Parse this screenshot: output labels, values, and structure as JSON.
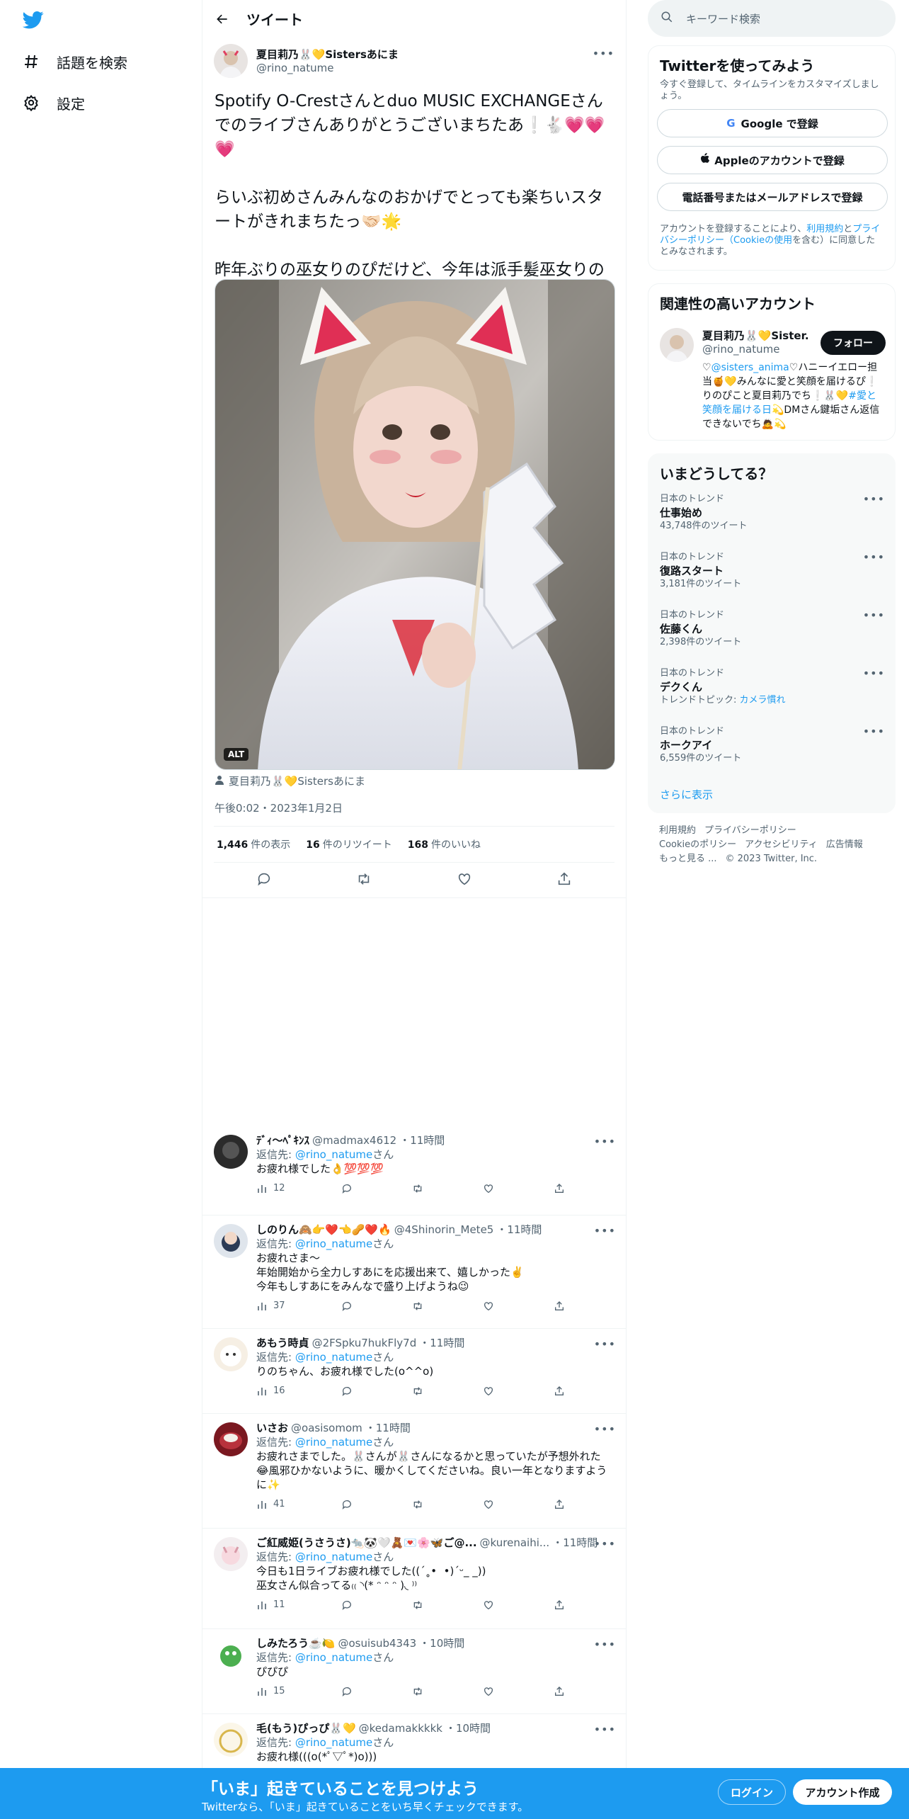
{
  "nav": {
    "explore": "話題を検索",
    "settings": "設定"
  },
  "header": {
    "title": "ツイート"
  },
  "tweet": {
    "display_name": "夏目莉乃🐰💛Sistersあにま",
    "handle": "@rino_natume",
    "text": "Spotify O-Crestさんとduo MUSIC EXCHANGEさんでのライブさんありがとうございまちたあ❕🐇💗💗💗\n\nらいぶ初めさんみんなのおかげでとっても楽ちいスタートがきれまちたっ🤝🏻🌟\n\n昨年ぶりの巫女りのぴだけど、今年は派手髪巫女りのぴ〜🦊🎶❤️",
    "alt_badge": "ALT",
    "tagged": "夏目莉乃🐰💛Sistersあにま",
    "timestamp": "午後0:02・2023年1月2日",
    "views_count": "1,446",
    "views_label": "件の表示",
    "retweets_count": "16",
    "retweets_label": "件のリツイート",
    "likes_count": "168",
    "likes_label": "件のいいね"
  },
  "replies": [
    {
      "name": "ﾃﾞｨ〜ﾍﾟｷﾝｽ",
      "handle": "@madmax4612",
      "time": "・11時間",
      "reply_prefix": "返信先: ",
      "reply_to": "@rino_natume",
      "reply_suffix": "さん",
      "text": "お疲れ様でした👌💯💯💯",
      "views": "12"
    },
    {
      "name": "しのりん🙈👉❤️👈🥜❤️🔥",
      "handle": "@4Shinorin_Mete5",
      "time": "・11時間",
      "reply_prefix": "返信先: ",
      "reply_to": "@rino_natume",
      "reply_suffix": "さん",
      "text": "お疲れさま〜\n年始開始から全力しすあにを応援出来て、嬉しかった✌️\n今年もしすあにをみんなで盛り上げようね😉",
      "views": "37"
    },
    {
      "name": "あもう時貞",
      "handle": "@2FSpku7hukFly7d",
      "time": "・11時間",
      "reply_prefix": "返信先: ",
      "reply_to": "@rino_natume",
      "reply_suffix": "さん",
      "text": "りのちゃん、お疲れ様でした(o^^o)",
      "views": "16"
    },
    {
      "name": "いさお",
      "handle": "@oasisomom",
      "time": "・11時間",
      "reply_prefix": "返信先: ",
      "reply_to": "@rino_natume",
      "reply_suffix": "さん",
      "text": "お疲れさまでした。🐰さんが🐰さんになるかと思っていたが予想外れた😂風邪ひかないように、暖かくしてくださいね。良い一年となりますように✨",
      "views": "41"
    },
    {
      "name": "ご紅威姫(うさうさ)🐀🐼🤍🧸💌🌸🦋ご@...",
      "handle": "@kurenaihi...",
      "time": "・11時間",
      "reply_prefix": "返信先: ",
      "reply_to": "@rino_natume",
      "reply_suffix": "さん",
      "text": "今日も1日ライブお疲れ様でした((´˳•  •)´ᵕ_ _))\n巫女さん似合ってる₍₍ ◝(* ᵔ ᵔ ᵔ )◟ ⁾⁾",
      "views": "11"
    },
    {
      "name": "しみたろう☕️🍋",
      "handle": "@osuisub4343",
      "time": "・10時間",
      "reply_prefix": "返信先: ",
      "reply_to": "@rino_natume",
      "reply_suffix": "さん",
      "text": "ぴぴぴ",
      "views": "15"
    },
    {
      "name": "毛(もう)ぴっぴ🐰💛",
      "handle": "@kedamakkkkk",
      "time": "・10時間",
      "reply_prefix": "返信先: ",
      "reply_to": "@rino_natume",
      "reply_suffix": "さん",
      "text": "お疲れ様(((o(*ﾟ▽ﾟ*)o)))",
      "views": ""
    }
  ],
  "right": {
    "search_placeholder": "キーワード検索",
    "signup": {
      "title": "Twitterを使ってみよう",
      "subtitle": "今すぐ登録して、タイムラインをカスタマイズしましょう。",
      "google": "Google で登録",
      "apple": "Appleのアカウントで登録",
      "phone": "電話番号またはメールアドレスで登録",
      "terms_a": "アカウントを登録することにより、",
      "terms_link1": "利用規約",
      "terms_b": "と",
      "terms_link2": "プライバシーポリシー（Cookieの使用",
      "terms_c": "を含む）に同意したとみなされます。"
    },
    "related": {
      "title": "関連性の高いアカウント",
      "name": "夏目莉乃🐰💛Sister...",
      "handle": "@rino_natume",
      "follow": "フォロー",
      "bio_a": "♡",
      "bio_link1": "@sisters_anima",
      "bio_b": "♡ハニーイエロー担当🍯💛みんなに愛と笑顔を届けるぴ❕りのぴこと夏目莉乃でち❕🐰💛",
      "bio_link2": "#愛と笑顔を届ける日",
      "bio_c": "💫DMさん鍵垢さん返信できないでち🙇💫"
    },
    "trends": {
      "title": "いまどうしてる？",
      "items": [
        {
          "context": "日本のトレンド",
          "name": "仕事始め",
          "count": "43,748件のツイート"
        },
        {
          "context": "日本のトレンド",
          "name": "復路スタート",
          "count": "3,181件のツイート"
        },
        {
          "context": "日本のトレンド",
          "name": "佐藤くん",
          "count": "2,398件のツイート"
        },
        {
          "context": "日本のトレンド",
          "name": "デクくん",
          "count": "トレンドトピック: ",
          "link": "カメラ慣れ"
        },
        {
          "context": "日本のトレンド",
          "name": "ホークアイ",
          "count": "6,559件のツイート"
        }
      ],
      "show_more": "さらに表示"
    },
    "footer": {
      "terms": "利用規約",
      "privacy": "プライバシーポリシー",
      "cookie": "Cookieのポリシー",
      "access": "アクセシビリティ",
      "ads": "広告情報",
      "more": "もっと見る ...",
      "copy": "© 2023 Twitter, Inc."
    }
  },
  "bottom_bar": {
    "title": "「いま」起きていることを見つけよう",
    "subtitle": "Twitterなら、「いま」起きていることをいち早くチェックできます。",
    "login": "ログイン",
    "signup": "アカウント作成"
  },
  "colors": {
    "accent": "#1d9bf0",
    "text": "#0f1419",
    "muted": "#536471"
  }
}
